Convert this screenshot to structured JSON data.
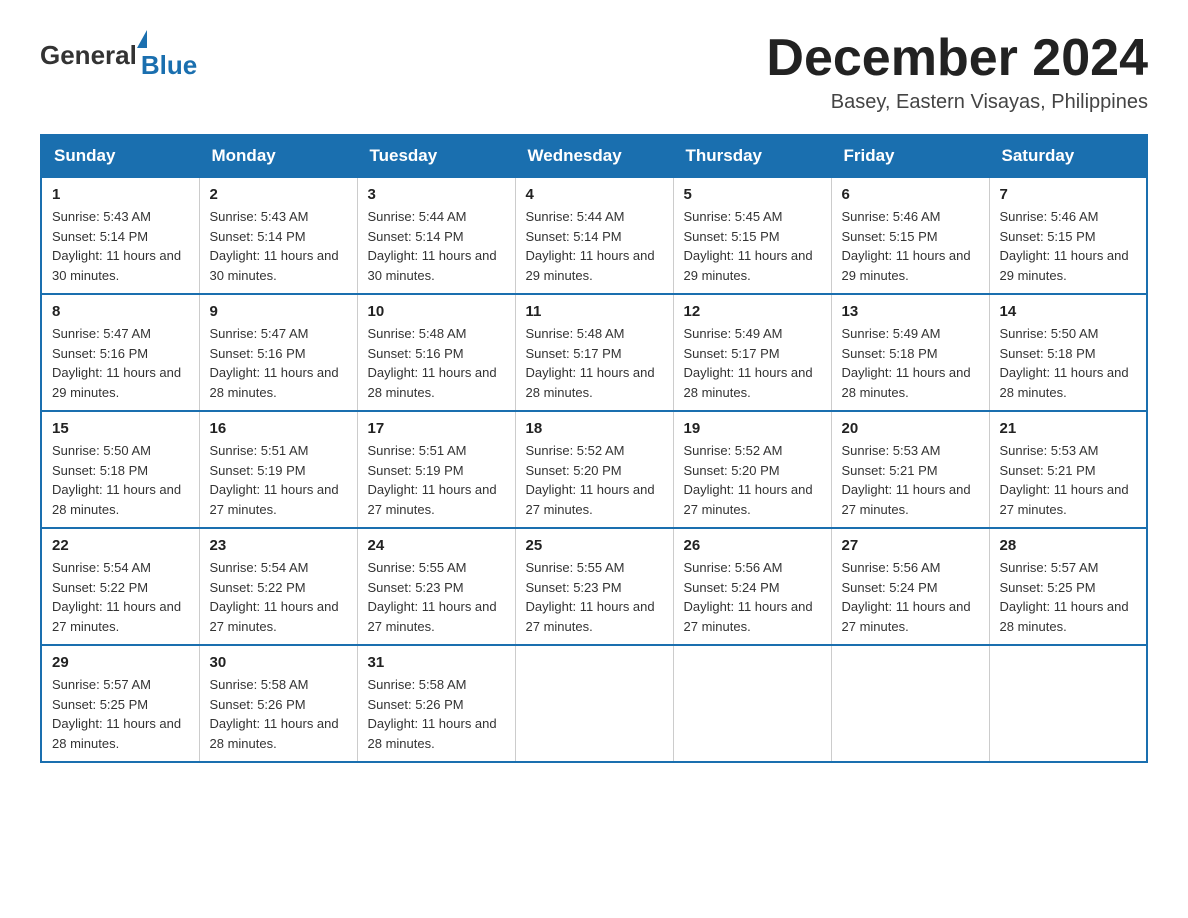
{
  "logo": {
    "general": "General",
    "blue": "Blue"
  },
  "title": "December 2024",
  "subtitle": "Basey, Eastern Visayas, Philippines",
  "days_of_week": [
    "Sunday",
    "Monday",
    "Tuesday",
    "Wednesday",
    "Thursday",
    "Friday",
    "Saturday"
  ],
  "weeks": [
    [
      {
        "day": "1",
        "sunrise": "5:43 AM",
        "sunset": "5:14 PM",
        "daylight": "11 hours and 30 minutes."
      },
      {
        "day": "2",
        "sunrise": "5:43 AM",
        "sunset": "5:14 PM",
        "daylight": "11 hours and 30 minutes."
      },
      {
        "day": "3",
        "sunrise": "5:44 AM",
        "sunset": "5:14 PM",
        "daylight": "11 hours and 30 minutes."
      },
      {
        "day": "4",
        "sunrise": "5:44 AM",
        "sunset": "5:14 PM",
        "daylight": "11 hours and 29 minutes."
      },
      {
        "day": "5",
        "sunrise": "5:45 AM",
        "sunset": "5:15 PM",
        "daylight": "11 hours and 29 minutes."
      },
      {
        "day": "6",
        "sunrise": "5:46 AM",
        "sunset": "5:15 PM",
        "daylight": "11 hours and 29 minutes."
      },
      {
        "day": "7",
        "sunrise": "5:46 AM",
        "sunset": "5:15 PM",
        "daylight": "11 hours and 29 minutes."
      }
    ],
    [
      {
        "day": "8",
        "sunrise": "5:47 AM",
        "sunset": "5:16 PM",
        "daylight": "11 hours and 29 minutes."
      },
      {
        "day": "9",
        "sunrise": "5:47 AM",
        "sunset": "5:16 PM",
        "daylight": "11 hours and 28 minutes."
      },
      {
        "day": "10",
        "sunrise": "5:48 AM",
        "sunset": "5:16 PM",
        "daylight": "11 hours and 28 minutes."
      },
      {
        "day": "11",
        "sunrise": "5:48 AM",
        "sunset": "5:17 PM",
        "daylight": "11 hours and 28 minutes."
      },
      {
        "day": "12",
        "sunrise": "5:49 AM",
        "sunset": "5:17 PM",
        "daylight": "11 hours and 28 minutes."
      },
      {
        "day": "13",
        "sunrise": "5:49 AM",
        "sunset": "5:18 PM",
        "daylight": "11 hours and 28 minutes."
      },
      {
        "day": "14",
        "sunrise": "5:50 AM",
        "sunset": "5:18 PM",
        "daylight": "11 hours and 28 minutes."
      }
    ],
    [
      {
        "day": "15",
        "sunrise": "5:50 AM",
        "sunset": "5:18 PM",
        "daylight": "11 hours and 28 minutes."
      },
      {
        "day": "16",
        "sunrise": "5:51 AM",
        "sunset": "5:19 PM",
        "daylight": "11 hours and 27 minutes."
      },
      {
        "day": "17",
        "sunrise": "5:51 AM",
        "sunset": "5:19 PM",
        "daylight": "11 hours and 27 minutes."
      },
      {
        "day": "18",
        "sunrise": "5:52 AM",
        "sunset": "5:20 PM",
        "daylight": "11 hours and 27 minutes."
      },
      {
        "day": "19",
        "sunrise": "5:52 AM",
        "sunset": "5:20 PM",
        "daylight": "11 hours and 27 minutes."
      },
      {
        "day": "20",
        "sunrise": "5:53 AM",
        "sunset": "5:21 PM",
        "daylight": "11 hours and 27 minutes."
      },
      {
        "day": "21",
        "sunrise": "5:53 AM",
        "sunset": "5:21 PM",
        "daylight": "11 hours and 27 minutes."
      }
    ],
    [
      {
        "day": "22",
        "sunrise": "5:54 AM",
        "sunset": "5:22 PM",
        "daylight": "11 hours and 27 minutes."
      },
      {
        "day": "23",
        "sunrise": "5:54 AM",
        "sunset": "5:22 PM",
        "daylight": "11 hours and 27 minutes."
      },
      {
        "day": "24",
        "sunrise": "5:55 AM",
        "sunset": "5:23 PM",
        "daylight": "11 hours and 27 minutes."
      },
      {
        "day": "25",
        "sunrise": "5:55 AM",
        "sunset": "5:23 PM",
        "daylight": "11 hours and 27 minutes."
      },
      {
        "day": "26",
        "sunrise": "5:56 AM",
        "sunset": "5:24 PM",
        "daylight": "11 hours and 27 minutes."
      },
      {
        "day": "27",
        "sunrise": "5:56 AM",
        "sunset": "5:24 PM",
        "daylight": "11 hours and 27 minutes."
      },
      {
        "day": "28",
        "sunrise": "5:57 AM",
        "sunset": "5:25 PM",
        "daylight": "11 hours and 28 minutes."
      }
    ],
    [
      {
        "day": "29",
        "sunrise": "5:57 AM",
        "sunset": "5:25 PM",
        "daylight": "11 hours and 28 minutes."
      },
      {
        "day": "30",
        "sunrise": "5:58 AM",
        "sunset": "5:26 PM",
        "daylight": "11 hours and 28 minutes."
      },
      {
        "day": "31",
        "sunrise": "5:58 AM",
        "sunset": "5:26 PM",
        "daylight": "11 hours and 28 minutes."
      },
      null,
      null,
      null,
      null
    ]
  ],
  "labels": {
    "sunrise": "Sunrise:",
    "sunset": "Sunset:",
    "daylight": "Daylight:"
  }
}
